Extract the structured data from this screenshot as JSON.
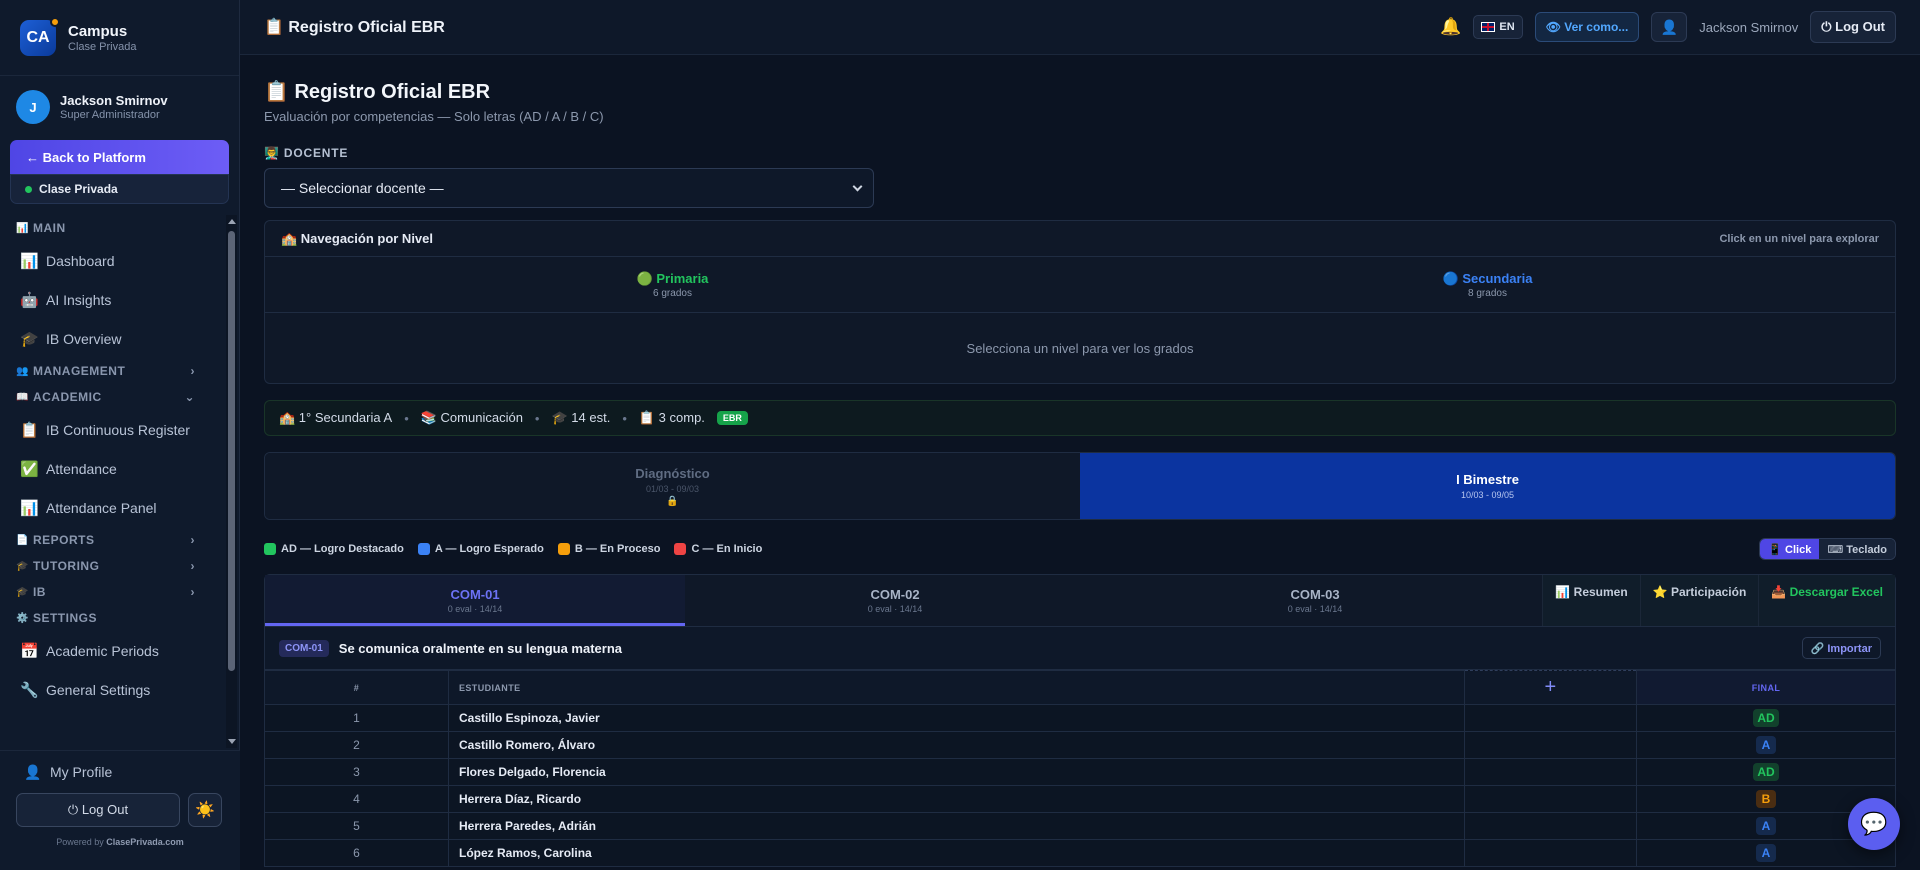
{
  "brand": {
    "logo": "CA",
    "name": "Campus",
    "sub": "Clase Privada"
  },
  "user": {
    "initial": "J",
    "name": "Jackson Smirnov",
    "role": "Super Administrador"
  },
  "sidebar": {
    "back_label": "← Back to Platform",
    "tenant": "Clase Privada",
    "nav": [
      {
        "kind": "section",
        "icon": "📊",
        "label": "MAIN",
        "chev": ""
      },
      {
        "kind": "item",
        "icon": "📊",
        "label": "Dashboard"
      },
      {
        "kind": "item",
        "icon": "🤖",
        "label": "AI Insights"
      },
      {
        "kind": "item",
        "icon": "🎓",
        "label": "IB Overview"
      },
      {
        "kind": "section",
        "icon": "👥",
        "label": "MANAGEMENT",
        "chev": "›"
      },
      {
        "kind": "section",
        "icon": "📖",
        "label": "ACADEMIC",
        "chev": "⌄"
      },
      {
        "kind": "item",
        "icon": "📋",
        "label": "IB Continuous Register"
      },
      {
        "kind": "item",
        "icon": "✅",
        "label": "Attendance"
      },
      {
        "kind": "item",
        "icon": "📊",
        "label": "Attendance Panel"
      },
      {
        "kind": "section",
        "icon": "📄",
        "label": "REPORTS",
        "chev": "›"
      },
      {
        "kind": "section",
        "icon": "🎓",
        "label": "TUTORING",
        "chev": "›"
      },
      {
        "kind": "section",
        "icon": "🎓",
        "label": "IB",
        "chev": "›"
      },
      {
        "kind": "section",
        "icon": "⚙️",
        "label": "SETTINGS",
        "chev": ""
      },
      {
        "kind": "item",
        "icon": "📅",
        "label": "Academic Periods"
      },
      {
        "kind": "item",
        "icon": "🔧",
        "label": "General Settings"
      }
    ],
    "my_profile": "My Profile",
    "logout": "⏻ Log Out",
    "theme_icon": "☀️",
    "powered_prefix": "Powered by ",
    "powered_brand": "ClasePrivada.com"
  },
  "topbar": {
    "title": "📋 Registro Oficial EBR",
    "bell": "🔔",
    "lang": "EN",
    "ver_como": "👁 Ver como...",
    "person_icon": "👤",
    "user": "Jackson Smirnov",
    "logout": "⏻ Log Out"
  },
  "page": {
    "title": "📋 Registro Oficial EBR",
    "subtitle": "Evaluación por competencias — Solo letras (AD / A / B / C)",
    "docente_label": "👨‍🏫 DOCENTE",
    "docente_select": "— Seleccionar docente —"
  },
  "nivel": {
    "title": "🏫 Navegación por Nivel",
    "hint": "Click en un nivel para explorar",
    "levels": [
      {
        "name": "🟢 Primaria",
        "grados": "6 grados",
        "color": "#22c55e"
      },
      {
        "name": "🔵 Secundaria",
        "grados": "8 grados",
        "color": "#3b82f6"
      }
    ],
    "empty": "Selecciona un nivel para ver los grados"
  },
  "info": {
    "section": "🏫 1° Secundaria A",
    "course": "📚 Comunicación",
    "students": "🎓 14 est.",
    "comps": "📋 3 comp.",
    "badge": "EBR",
    "sep": "•"
  },
  "periods": [
    {
      "name": "Diagnóstico",
      "dates": "01/03 - 09/03",
      "locked": "🔒",
      "active": false
    },
    {
      "name": "I Bimestre",
      "dates": "10/03 - 09/05",
      "locked": "",
      "active": true
    }
  ],
  "legend": [
    {
      "label": "AD — Logro Destacado",
      "color": "#22c55e"
    },
    {
      "label": "A — Logro Esperado",
      "color": "#3b82f6"
    },
    {
      "label": "B — En Proceso",
      "color": "#f59e0b"
    },
    {
      "label": "C — En Inicio",
      "color": "#ef4444"
    }
  ],
  "mode": {
    "click": "📱 Click",
    "teclado": "⌨ Teclado"
  },
  "comp_tabs": [
    {
      "code": "COM-01",
      "sub": "0 eval · 14/14",
      "active": true
    },
    {
      "code": "COM-02",
      "sub": "0 eval · 14/14",
      "active": false
    },
    {
      "code": "COM-03",
      "sub": "0 eval · 14/14",
      "active": false
    }
  ],
  "tab_actions": {
    "resumen": "📊 Resumen",
    "participacion": "⭐ Participación",
    "excel": "📥 Descargar Excel"
  },
  "competency": {
    "code": "COM-01",
    "name": "Se comunica oralmente en su lengua materna",
    "import": "🔗 Importar"
  },
  "table": {
    "headers": {
      "num": "#",
      "student": "ESTUDIANTE",
      "add": "+",
      "final": "FINAL"
    },
    "rows": [
      {
        "n": "1",
        "name": "Castillo Espinoza, Javier",
        "final": "AD"
      },
      {
        "n": "2",
        "name": "Castillo Romero, Álvaro",
        "final": "A"
      },
      {
        "n": "3",
        "name": "Flores Delgado, Florencia",
        "final": "AD"
      },
      {
        "n": "4",
        "name": "Herrera Díaz, Ricardo",
        "final": "B"
      },
      {
        "n": "5",
        "name": "Herrera Paredes, Adrián",
        "final": "A"
      },
      {
        "n": "6",
        "name": "López Ramos, Carolina",
        "final": "A"
      }
    ]
  },
  "chat_icon": "💬"
}
